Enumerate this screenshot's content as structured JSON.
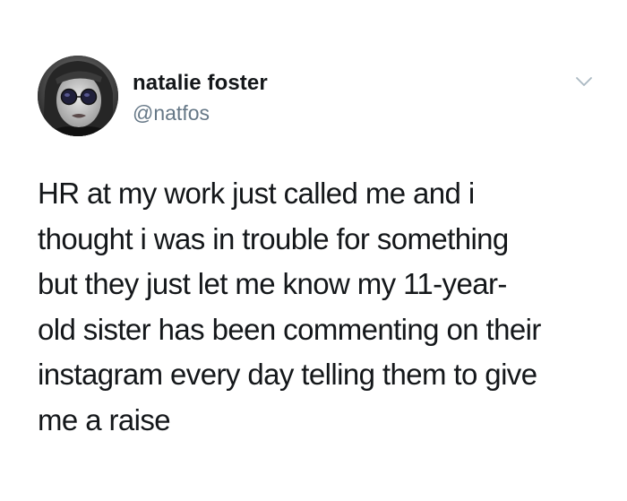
{
  "author": {
    "display_name": "natalie foster",
    "handle": "@natfos"
  },
  "tweet": {
    "text_lines": [
      "HR at my work just called me and i",
      "thought i was in trouble for something",
      "but they just let me know my 11-year-",
      "old sister has been commenting on their",
      "instagram every day telling them to give",
      "me a raise"
    ]
  },
  "icons": {
    "more_menu": "chevron-down-icon"
  },
  "colors": {
    "text": "#14171a",
    "secondary": "#657786",
    "chevron": "#aab8c2",
    "background": "#ffffff"
  }
}
